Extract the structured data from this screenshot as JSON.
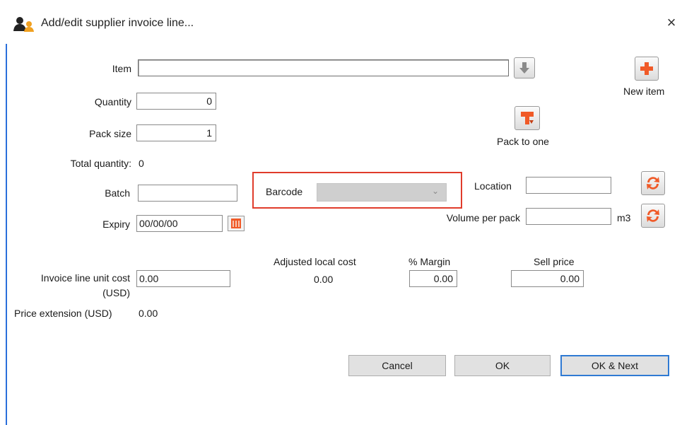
{
  "window": {
    "title": "Add/edit supplier invoice line...",
    "close_glyph": "×",
    "app_icon": "people-icon"
  },
  "form": {
    "item": {
      "label": "Item",
      "value": ""
    },
    "quantity": {
      "label": "Quantity",
      "value": "0"
    },
    "pack_size": {
      "label": "Pack size",
      "value": "1"
    },
    "total_quantity": {
      "label": "Total quantity:",
      "value": "0"
    },
    "batch": {
      "label": "Batch",
      "value": ""
    },
    "expiry": {
      "label": "Expiry",
      "value": "00/00/00"
    },
    "barcode": {
      "label": "Barcode",
      "value": ""
    },
    "location": {
      "label": "Location",
      "value": ""
    },
    "volume_per_pack": {
      "label": "Volume per pack",
      "value": "",
      "unit": "m3"
    },
    "invoice_line_unit_cost": {
      "label_line1": "Invoice line unit cost",
      "label_line2": "(USD)",
      "value": "0.00"
    },
    "adjusted_local_cost": {
      "label": "Adjusted local cost",
      "value": "0.00"
    },
    "margin": {
      "label": "% Margin",
      "value": "0.00"
    },
    "sell_price": {
      "label": "Sell price",
      "value": "0.00"
    },
    "price_extension": {
      "label": "Price extension (USD)",
      "value": "0.00"
    }
  },
  "actions": {
    "new_item": "New item",
    "pack_to_one": "Pack to one",
    "cancel": "Cancel",
    "ok": "OK",
    "ok_next": "OK & Next"
  },
  "colors": {
    "accent_orange": "#f05a28",
    "highlight_red": "#e03c2b",
    "default_button_blue": "#2f7ad3"
  }
}
